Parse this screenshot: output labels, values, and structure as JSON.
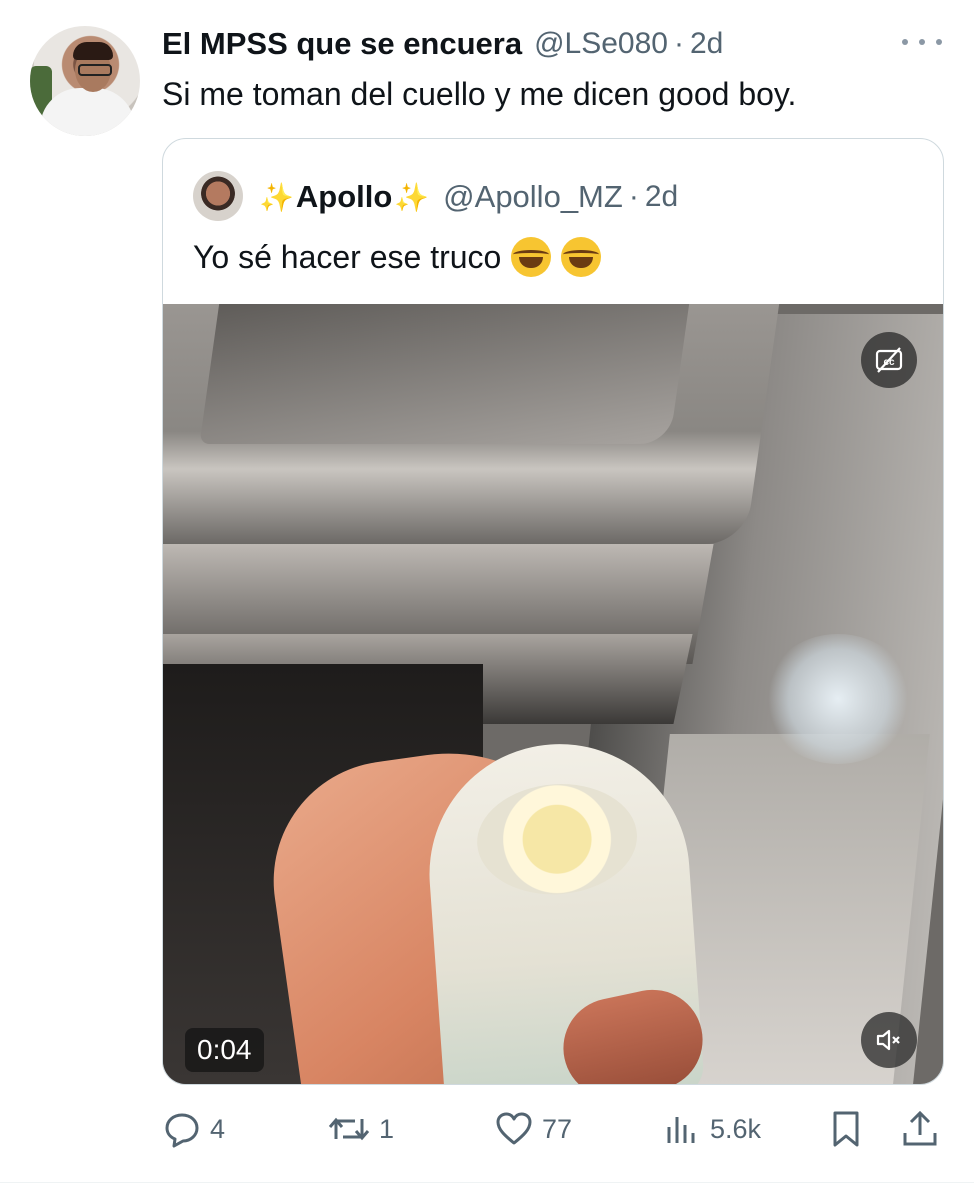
{
  "tweet": {
    "author_name": "El MPSS que se encuera",
    "handle": "@LSe080",
    "separator": "·",
    "time": "2d",
    "text": "Si me toman del cuello y me dicen good boy."
  },
  "quoted_tweet": {
    "sparkle_left": "✨",
    "author_name": "Apollo",
    "sparkle_right": "✨",
    "handle": "@Apollo_MZ",
    "separator": "·",
    "time": "2d",
    "text": "Yo sé hacer ese truco",
    "emojis": [
      "face-with-tears-of-joy",
      "face-with-tears-of-joy"
    ],
    "video": {
      "duration": "0:04",
      "icons": [
        "captions-off-icon",
        "volume-muted-icon"
      ]
    }
  },
  "actions": {
    "replies": "4",
    "reposts": "1",
    "likes": "77",
    "views": "5.6k"
  },
  "colors": {
    "text_primary": "#0f1419",
    "text_secondary": "#536471",
    "border": "#cfd9de"
  }
}
